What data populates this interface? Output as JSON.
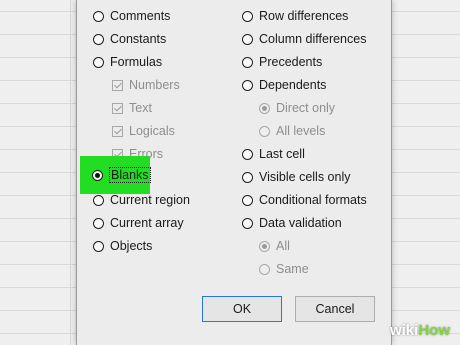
{
  "left_column": [
    {
      "label": "Comments",
      "state": "radio",
      "checked": false,
      "disabled": false
    },
    {
      "label": "Constants",
      "state": "radio",
      "checked": false,
      "disabled": false
    },
    {
      "label": "Formulas",
      "state": "radio",
      "checked": false,
      "disabled": false
    },
    {
      "label": "Numbers",
      "state": "checkbox",
      "checked": true,
      "disabled": true
    },
    {
      "label": "Text",
      "state": "checkbox",
      "checked": true,
      "disabled": true
    },
    {
      "label": "Logicals",
      "state": "checkbox",
      "checked": true,
      "disabled": true
    },
    {
      "label": "Errors",
      "state": "checkbox",
      "checked": true,
      "disabled": true
    },
    {
      "label": "Blanks",
      "state": "radio",
      "checked": true,
      "disabled": false
    },
    {
      "label": "Current region",
      "state": "radio",
      "checked": false,
      "disabled": false
    },
    {
      "label": "Current array",
      "state": "radio",
      "checked": false,
      "disabled": false
    },
    {
      "label": "Objects",
      "state": "radio",
      "checked": false,
      "disabled": false
    }
  ],
  "right_column": [
    {
      "label": "Row differences",
      "state": "radio",
      "checked": false,
      "disabled": false
    },
    {
      "label": "Column differences",
      "state": "radio",
      "checked": false,
      "disabled": false
    },
    {
      "label": "Precedents",
      "state": "radio",
      "checked": false,
      "disabled": false
    },
    {
      "label": "Dependents",
      "state": "radio",
      "checked": false,
      "disabled": false
    },
    {
      "label": "Direct only",
      "state": "radio",
      "checked": true,
      "disabled": true
    },
    {
      "label": "All levels",
      "state": "radio",
      "checked": false,
      "disabled": true
    },
    {
      "label": "Last cell",
      "state": "radio",
      "checked": false,
      "disabled": false
    },
    {
      "label": "Visible cells only",
      "state": "radio",
      "checked": false,
      "disabled": false
    },
    {
      "label": "Conditional formats",
      "state": "radio",
      "checked": false,
      "disabled": false
    },
    {
      "label": "Data validation",
      "state": "radio",
      "checked": false,
      "disabled": false
    },
    {
      "label": "All",
      "state": "radio",
      "checked": true,
      "disabled": true
    },
    {
      "label": "Same",
      "state": "radio",
      "checked": false,
      "disabled": true
    }
  ],
  "buttons": {
    "ok": "OK",
    "cancel": "Cancel"
  },
  "watermark": {
    "wiki": "wiki",
    "how": "How"
  },
  "colors": {
    "highlight": "#22dd22",
    "default_button_border": "#2b77d6"
  }
}
